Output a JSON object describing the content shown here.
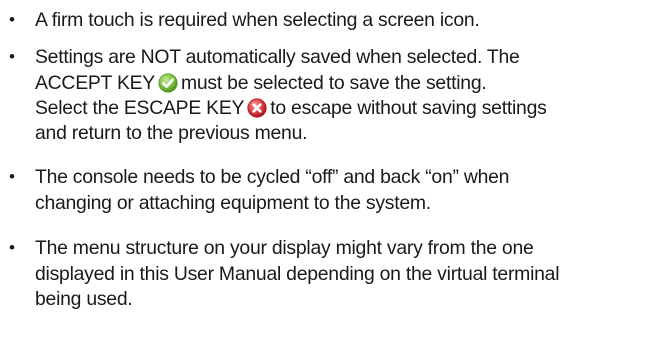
{
  "notes": [
    {
      "lines": [
        "A firm touch is required when selecting a screen icon."
      ]
    },
    {
      "line1": "Settings are NOT automatically saved when selected. The",
      "line2_before": "ACCEPT KEY",
      "line2_after": "must be selected to save the setting.",
      "line3_before": "Select the ESCAPE KEY",
      "line3_after": "to escape without saving settings",
      "line4": "and return to the previous menu.",
      "accept_icon": "green-checkmark-icon",
      "escape_icon": "red-x-icon",
      "accept_color": "#7cbf3a",
      "escape_color": "#d9363e"
    },
    {
      "lines": [
        "The console needs to be cycled “off” and back “on” when",
        "changing or attaching equipment to the system."
      ]
    },
    {
      "lines": [
        "The menu structure on your display might vary from the one",
        "displayed in this User Manual depending on the virtual terminal",
        "being used."
      ]
    }
  ],
  "bullet_char": "•"
}
